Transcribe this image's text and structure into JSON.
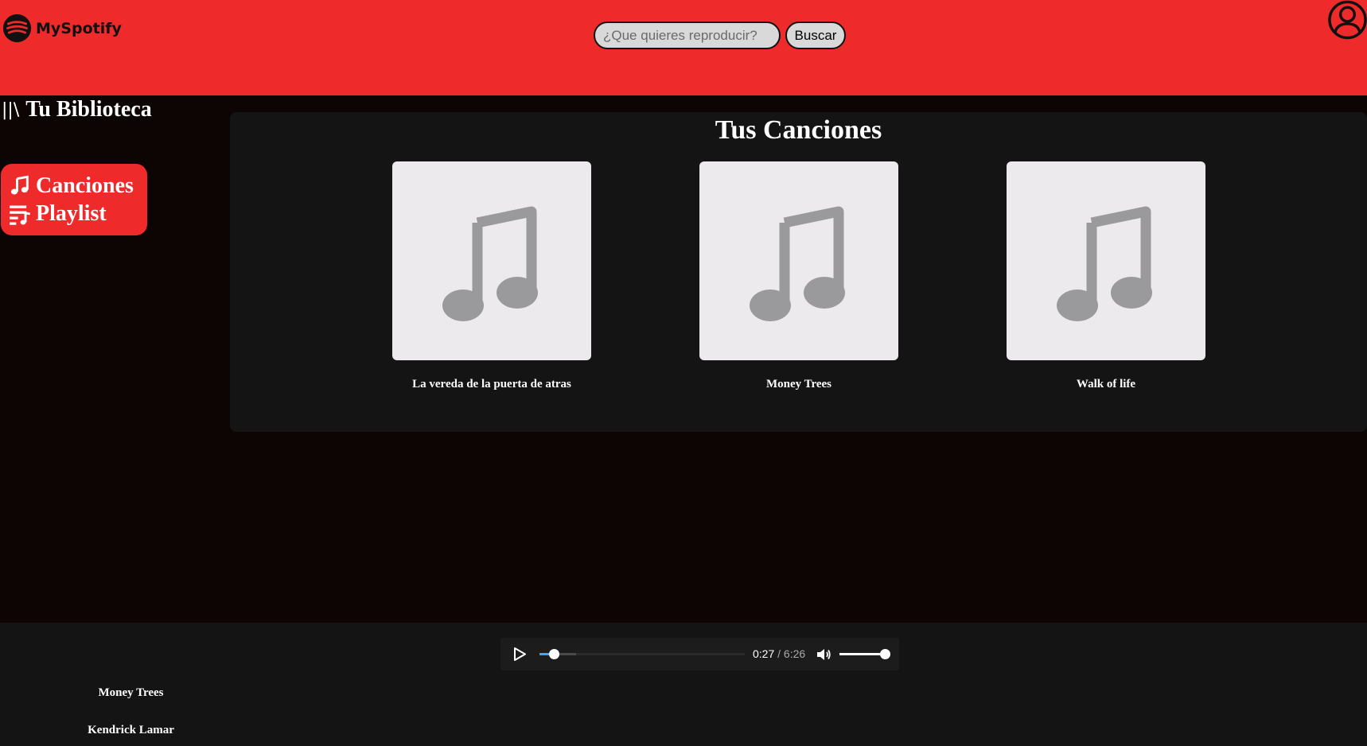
{
  "header": {
    "app_name": "MySpotify",
    "search_placeholder": "¿Que quieres reproducir?",
    "search_button": "Buscar",
    "accent_color": "#ee2a2b"
  },
  "sidebar": {
    "library_icon": "library-icon",
    "library_glyph": "||\\",
    "library_title": "Tu Biblioteca",
    "items": [
      {
        "label": "Canciones",
        "icon": "music-note-icon"
      },
      {
        "label": "Playlist",
        "icon": "playlist-icon"
      }
    ]
  },
  "main": {
    "title": "Tus Canciones",
    "songs": [
      {
        "title": "La vereda de la puerta de atras",
        "cover_icon": "music-note-icon"
      },
      {
        "title": "Money Trees",
        "cover_icon": "music-note-icon"
      },
      {
        "title": "Walk of life",
        "cover_icon": "music-note-icon"
      }
    ]
  },
  "player": {
    "current_time": "0:27",
    "duration": "6:26",
    "time_separator": " / ",
    "progress_fraction": 0.07,
    "buffered_fraction": 0.18,
    "volume_fraction": 1.0,
    "progress_color": "#3ea6ff"
  },
  "now_playing": {
    "title": "Money Trees",
    "artist": "Kendrick Lamar"
  }
}
